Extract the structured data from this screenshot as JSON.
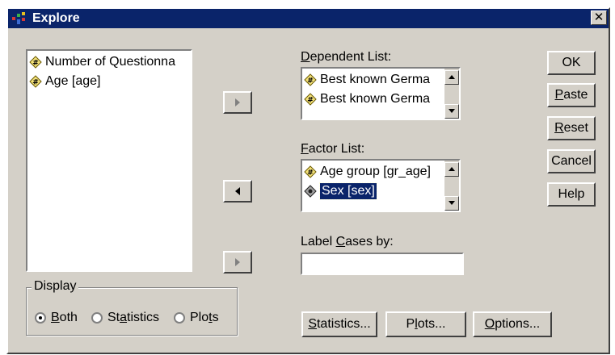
{
  "window": {
    "title": "Explore",
    "close_glyph": "✕"
  },
  "variables": {
    "items": [
      {
        "label": "Number of Questionna",
        "icon": "scale-variable-icon"
      },
      {
        "label": "Age [age]",
        "icon": "scale-variable-icon"
      }
    ]
  },
  "dependent": {
    "label_prefix": "",
    "label_underline": "D",
    "label_rest": "ependent List:",
    "items": [
      {
        "label": "Best known Germa",
        "icon": "scale-variable-icon"
      },
      {
        "label": "Best known Germa",
        "icon": "scale-variable-icon"
      }
    ]
  },
  "factor": {
    "label_underline": "F",
    "label_rest": "actor List:",
    "items": [
      {
        "label": "Age group [gr_age]",
        "icon": "scale-variable-icon"
      },
      {
        "label": "Sex [sex]",
        "icon": "nominal-variable-icon",
        "selected": true
      }
    ]
  },
  "label_cases": {
    "label_prefix": "Label ",
    "label_underline": "C",
    "label_rest": "ases by:",
    "value": ""
  },
  "buttons": {
    "ok": "OK",
    "paste_u": "P",
    "paste_rest": "aste",
    "reset_u": "R",
    "reset_rest": "eset",
    "cancel": "Cancel",
    "help": "Help",
    "statistics_u": "S",
    "statistics_rest": "tatistics...",
    "plots_pre": "P",
    "plots_u": "l",
    "plots_rest": "ots...",
    "options_u": "O",
    "options_rest": "ptions..."
  },
  "display": {
    "legend": "Display",
    "both_u": "B",
    "both_rest": "oth",
    "statistics_pre": "St",
    "statistics_u": "a",
    "statistics_rest": "tistics",
    "plots_pre": "Plo",
    "plots_u": "t",
    "plots_rest": "s",
    "selected": "both"
  }
}
